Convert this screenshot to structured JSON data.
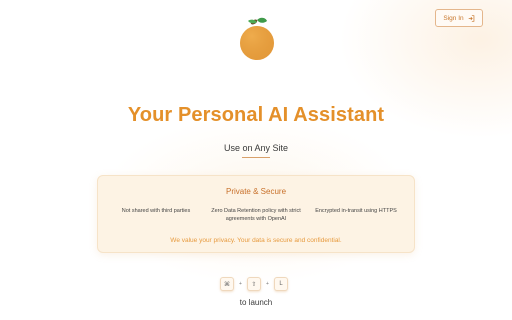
{
  "header": {
    "sign_in_label": "Sign In"
  },
  "hero": {
    "title": "Your Personal AI Assistant",
    "subtitle": "Use on Any Site"
  },
  "privacy_card": {
    "title": "Private & Secure",
    "features": [
      "Not shared with third parties",
      "Zero Data Retention policy with strict agreements with OpenAI",
      "Encrypted in-transit using HTTPS"
    ],
    "note": "We value your privacy. Your data is secure and confidential."
  },
  "shortcut": {
    "keys": [
      "⌘",
      "⇧",
      "L"
    ],
    "separator": "+",
    "caption": "to launch"
  },
  "colors": {
    "accent": "#e4902a",
    "logo_fruit": "#e8a040",
    "logo_leaf": "#3f9a4a",
    "card_bg": "#fdf3e4"
  },
  "icons": {
    "sign_in": "sign-in-icon",
    "logo": "orange-logo-icon"
  }
}
